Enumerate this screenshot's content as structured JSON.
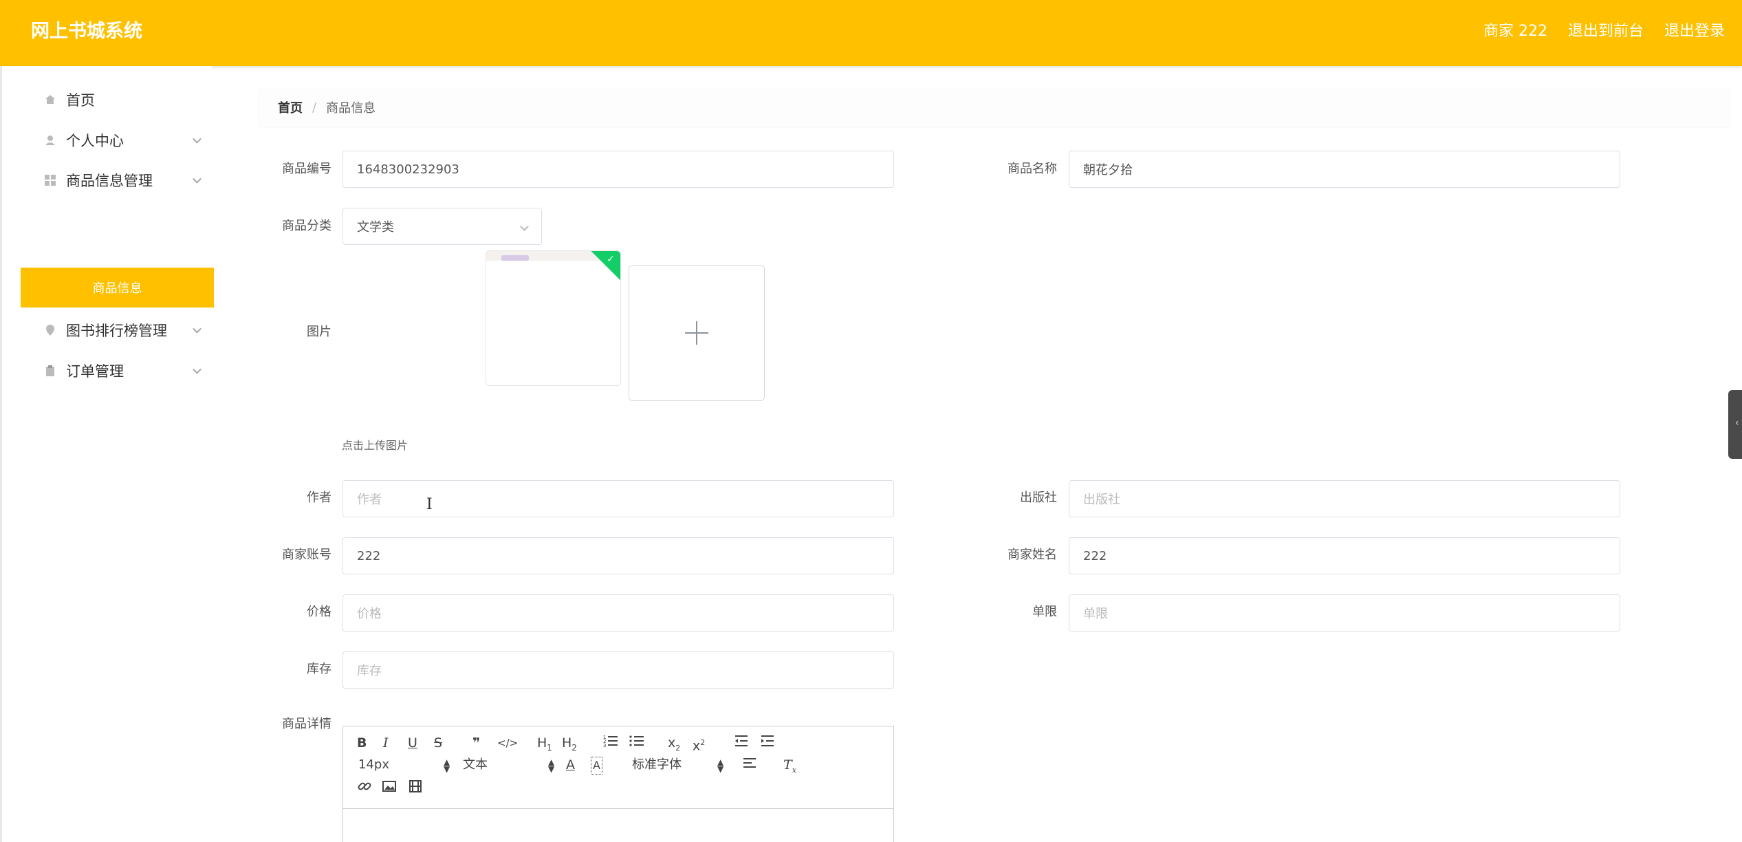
{
  "header": {
    "title": "网上书城系统",
    "user": "商家 222",
    "back_to_front": "退出到前台",
    "logout": "退出登录"
  },
  "sidebar": {
    "items": [
      {
        "label": "首页",
        "icon": "home-icon"
      },
      {
        "label": "个人中心",
        "icon": "user-icon"
      },
      {
        "label": "商品信息管理",
        "icon": "grid-icon"
      },
      {
        "label": "图书排行榜管理",
        "icon": "pin-icon"
      },
      {
        "label": "订单管理",
        "icon": "clipboard-icon"
      }
    ],
    "active_sub": "商品信息"
  },
  "breadcrumb": {
    "home": "首页",
    "separator": "/",
    "current": "商品信息"
  },
  "form": {
    "code_label": "商品编号",
    "code_value": "1648300232903",
    "name_label": "商品名称",
    "name_value": "朝花夕拾",
    "category_label": "商品分类",
    "category_value": "文学类",
    "image_label": "图片",
    "upload_tip": "点击上传图片",
    "author_label": "作者",
    "author_placeholder": "作者",
    "publisher_label": "出版社",
    "publisher_placeholder": "出版社",
    "account_label": "商家账号",
    "account_value": "222",
    "merchant_name_label": "商家姓名",
    "merchant_name_value": "222",
    "price_label": "价格",
    "price_placeholder": "价格",
    "limit_label": "单限",
    "limit_placeholder": "单限",
    "stock_label": "库存",
    "stock_placeholder": "库存",
    "detail_label": "商品详情"
  },
  "editor": {
    "font_size": "14px",
    "block_type": "文本",
    "font_family": "标准字体"
  },
  "colors": {
    "brand": "#ffc000",
    "success": "#13ce66"
  }
}
